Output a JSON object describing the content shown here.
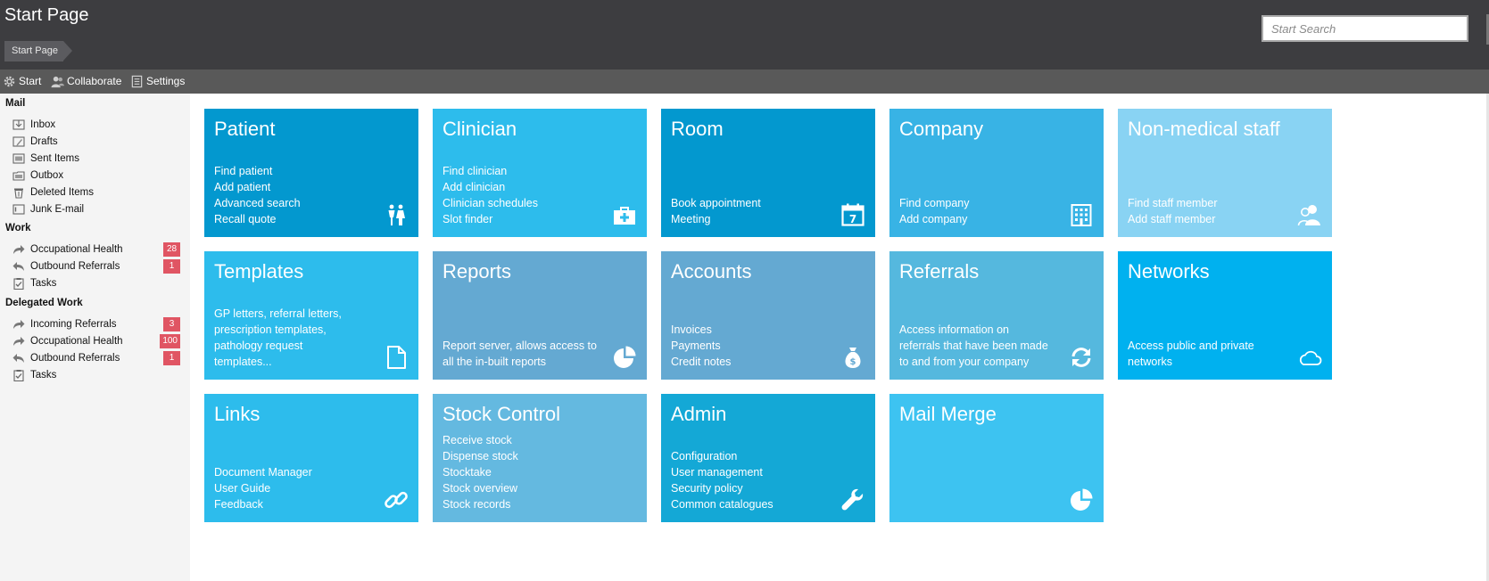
{
  "header": {
    "title": "Start Page",
    "breadcrumb": "Start Page",
    "search_placeholder": "Start Search"
  },
  "toolbar": {
    "start": "Start",
    "collaborate": "Collaborate",
    "settings": "Settings"
  },
  "sidebar": {
    "mail_header": "Mail",
    "mail": [
      {
        "label": "Inbox",
        "icon": "inbox-icon"
      },
      {
        "label": "Drafts",
        "icon": "drafts-icon"
      },
      {
        "label": "Sent Items",
        "icon": "sent-items-icon"
      },
      {
        "label": "Outbox",
        "icon": "outbox-icon"
      },
      {
        "label": "Deleted Items",
        "icon": "trash-icon"
      },
      {
        "label": "Junk E-mail",
        "icon": "junk-icon"
      }
    ],
    "work_header": "Work",
    "work": [
      {
        "label": "Occupational Health",
        "badge": "28",
        "icon": "forward-arrow-icon"
      },
      {
        "label": "Outbound Referrals",
        "badge": "1",
        "icon": "reply-arrow-icon"
      },
      {
        "label": "Tasks",
        "badge": "",
        "icon": "clipboard-check-icon"
      }
    ],
    "delegated_header": "Delegated Work",
    "delegated": [
      {
        "label": "Incoming Referrals",
        "badge": "3",
        "icon": "forward-arrow-icon"
      },
      {
        "label": "Occupational Health",
        "badge": "100",
        "icon": "forward-arrow-icon"
      },
      {
        "label": "Outbound Referrals",
        "badge": "1",
        "icon": "reply-arrow-icon"
      },
      {
        "label": "Tasks",
        "badge": "",
        "icon": "clipboard-check-icon"
      }
    ]
  },
  "tiles": {
    "patient": {
      "title": "Patient",
      "lines": [
        "Find patient",
        "Add patient",
        "Advanced search",
        "Recall quote"
      ],
      "icon": "people-icon",
      "color": "#0398cf"
    },
    "clinician": {
      "title": "Clinician",
      "lines": [
        "Find clinician",
        "Add clinician",
        "Clinician schedules",
        "Slot finder"
      ],
      "icon": "medical-bag-icon",
      "color": "#2dbcec"
    },
    "room": {
      "title": "Room",
      "lines": [
        "Book appointment",
        "Meeting"
      ],
      "icon": "calendar-icon",
      "color": "#0398cf"
    },
    "company": {
      "title": "Company",
      "lines": [
        "Find company",
        "Add company"
      ],
      "icon": "building-icon",
      "color": "#38b3e5"
    },
    "nonmedical": {
      "title": "Non-medical staff",
      "lines": [
        "Find staff member",
        "Add staff member"
      ],
      "icon": "users-icon",
      "color": "#89d3f3"
    },
    "templates": {
      "title": "Templates",
      "lines": [
        "GP letters, referral letters,",
        "prescription templates,",
        "pathology request",
        "templates..."
      ],
      "icon": "document-icon",
      "color": "#2dbcec"
    },
    "reports": {
      "title": "Reports",
      "lines": [
        "Report server, allows access to",
        "all the in-built reports"
      ],
      "icon": "pie-chart-icon",
      "color": "#64a9d2"
    },
    "accounts": {
      "title": "Accounts",
      "lines": [
        "Invoices",
        "Payments",
        "Credit notes"
      ],
      "icon": "money-bag-icon",
      "color": "#64a9d2"
    },
    "referrals": {
      "title": "Referrals",
      "lines": [
        "Access information on",
        "referrals that have been made",
        "to and from your company"
      ],
      "icon": "refresh-icon",
      "color": "#55b8de"
    },
    "networks": {
      "title": "Networks",
      "lines": [
        "Access public and private",
        "networks"
      ],
      "icon": "cloud-icon",
      "color": "#00b1ef"
    },
    "links": {
      "title": "Links",
      "lines": [
        "Document Manager",
        "User Guide",
        "Feedback"
      ],
      "icon": "link-icon",
      "color": "#2dbcec"
    },
    "stock": {
      "title": "Stock Control",
      "lines": [
        "Receive stock",
        "Dispense stock",
        "Stocktake",
        "Stock overview",
        "Stock records"
      ],
      "icon": "",
      "color": "#64b9e0"
    },
    "admin": {
      "title": "Admin",
      "lines": [
        "Configuration",
        "User management",
        "Security policy",
        "Common catalogues"
      ],
      "icon": "wrench-icon",
      "color": "#14a8d6"
    },
    "mailmerge": {
      "title": "Mail Merge",
      "lines": [],
      "icon": "pie-chart-icon",
      "color": "#3dc3f1"
    }
  }
}
